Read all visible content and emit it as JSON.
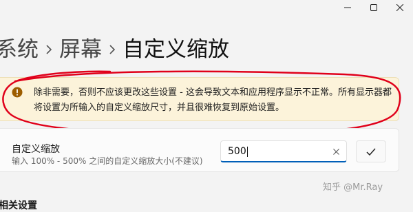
{
  "breadcrumb": {
    "items": [
      "系统",
      "屏幕",
      "自定义缩放"
    ]
  },
  "warning": {
    "text": "除非需要，否则不应该更改这些设置 - 这会导致文本和应用程序显示不正常。所有显示器都将设置为所输入的自定义缩放尺寸，并且很难恢复到原始设置。",
    "icon": "warning-icon"
  },
  "custom_scaling": {
    "title": "自定义缩放",
    "description": "输入 100% - 500% 之间的自定义缩放大小(不建议)",
    "value": "500"
  },
  "section_heading": "相关设置",
  "watermark": "知乎 @Mr.Ray",
  "colors": {
    "accent": "#005fb8",
    "warning_bg": "#fcf3da",
    "warning_icon": "#9d5d00",
    "annotation": "#e0001a"
  }
}
